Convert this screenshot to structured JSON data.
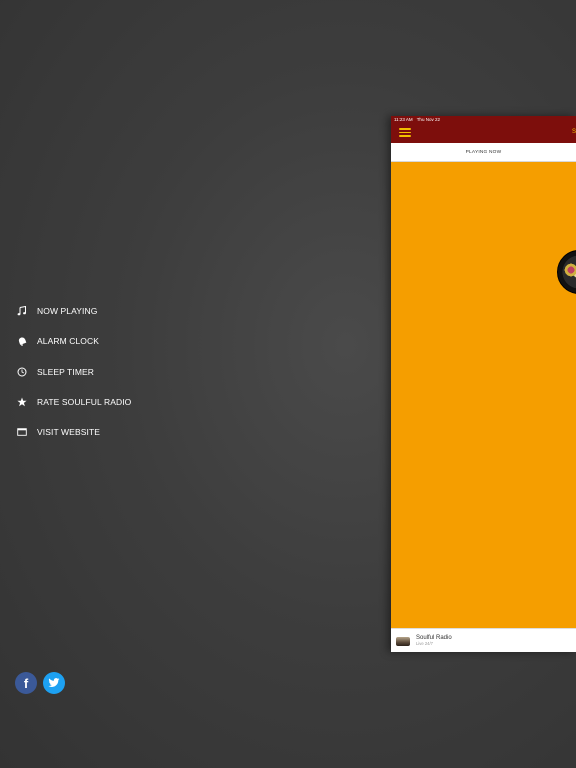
{
  "menu": {
    "items": [
      {
        "label": "NOW PLAYING",
        "icon": "music-note-icon"
      },
      {
        "label": "ALARM CLOCK",
        "icon": "alarm-bell-icon"
      },
      {
        "label": "SLEEP TIMER",
        "icon": "clock-icon"
      },
      {
        "label": "RATE SOULFUL RADIO",
        "icon": "star-icon"
      },
      {
        "label": "VISIT WEBSITE",
        "icon": "browser-window-icon"
      }
    ]
  },
  "social": {
    "facebook_glyph": "f",
    "twitter_glyph": "t"
  },
  "app": {
    "status": {
      "time": "11:23 AM",
      "date": "Thu Nov 22"
    },
    "header_title": "S",
    "tab_label": "PLAYING NOW",
    "player": {
      "title": "Soulful Radio",
      "subtitle": "Live 24/7"
    }
  },
  "colors": {
    "background": "#3d3d3d",
    "header": "#7d0e0c",
    "accent_yellow": "#f3c000",
    "content_orange": "#f59e00",
    "facebook": "#3b5998",
    "twitter": "#1da1f2"
  }
}
